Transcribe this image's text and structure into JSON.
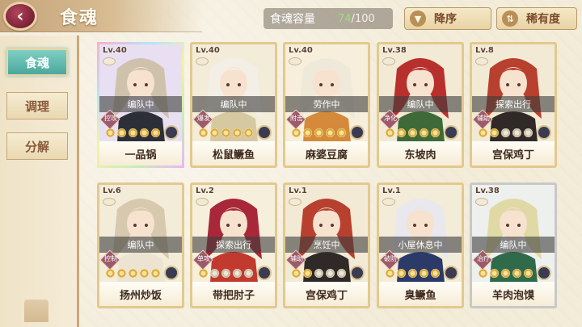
{
  "header": {
    "back_label": "‹",
    "title": "食魂",
    "capacity_label": "食魂容量",
    "capacity_used": "74",
    "capacity_max": "100",
    "order_label": "降序",
    "order_icon": "▼",
    "rarity_label": "稀有度",
    "rarity_icon": "⇅"
  },
  "sidebar": {
    "items": [
      {
        "label": "食魂",
        "active": true
      },
      {
        "label": "调理",
        "active": false
      },
      {
        "label": "分解",
        "active": false
      }
    ]
  },
  "cards": [
    {
      "level": "Lv.40",
      "status": "编队中",
      "role": "控攻",
      "name": "一品锅",
      "stars": 5,
      "hair": "#cfc2ad",
      "outfit": "#2d2f38",
      "bg": "#e8e0f2",
      "frame": "rainbow"
    },
    {
      "level": "Lv.40",
      "status": "编队中",
      "role": "爆发",
      "name": "松鼠鳜鱼",
      "stars": 5,
      "hair": "#f3efe6",
      "outfit": "#d6c9a2",
      "bg": "#f3ecd9",
      "frame": "gold"
    },
    {
      "level": "Lv.40",
      "status": "劳作中",
      "role": "附击",
      "name": "麻婆豆腐",
      "stars": 5,
      "hair": "#efe9d9",
      "outfit": "#d48a3a",
      "bg": "#f7efdc",
      "frame": "gold"
    },
    {
      "level": "Lv.38",
      "status": "编队中",
      "role": "净化",
      "name": "东坡肉",
      "stars": 5,
      "hair": "#b8302e",
      "outfit": "#3e6a3a",
      "bg": "#f2ead4",
      "frame": "gold"
    },
    {
      "level": "Lv.8",
      "status": "探索出行",
      "role": "辅助",
      "name": "宫保鸡丁",
      "stars": 2,
      "hair": "#b8402e",
      "outfit": "#2f2a28",
      "bg": "#f2ead4",
      "frame": "gold"
    },
    {
      "level": "Lv.6",
      "status": "编队中",
      "role": "控制",
      "name": "扬州炒饭",
      "stars": 5,
      "hair": "#d7c9ad",
      "outfit": "#ece4d0",
      "bg": "#f3ecd9",
      "frame": "gold"
    },
    {
      "level": "Lv.2",
      "status": "探索出行",
      "role": "单攻",
      "name": "带把肘子",
      "stars": 1,
      "hair": "#a8283a",
      "outfit": "#c23a2f",
      "bg": "#f6efdc",
      "frame": "gold"
    },
    {
      "level": "Lv.1",
      "status": "烹饪中",
      "role": "辅助",
      "name": "宫保鸡丁",
      "stars": 2,
      "hair": "#b8402e",
      "outfit": "#2f2a28",
      "bg": "#f2ead4",
      "frame": "gold"
    },
    {
      "level": "Lv.1",
      "status": "小屋休息中",
      "role": "破防",
      "name": "臭鳜鱼",
      "stars": 5,
      "hair": "#e8e8ee",
      "outfit": "#2c3a6a",
      "bg": "#f3ecd9",
      "frame": "gold"
    },
    {
      "level": "Lv.38",
      "status": "编队中",
      "role": "治疗",
      "name": "羊肉泡馍",
      "stars": 5,
      "hair": "#e0d9a6",
      "outfit": "#2f6a4a",
      "bg": "#eef0ee",
      "frame": "silver"
    }
  ]
}
